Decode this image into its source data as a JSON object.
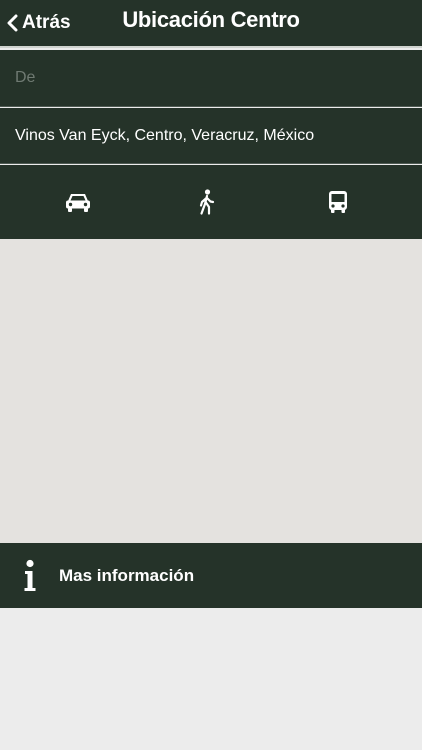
{
  "header": {
    "back_label": "Atrás",
    "title": "Ubicación Centro"
  },
  "route": {
    "from_placeholder": "De",
    "from_value": "",
    "to_value": "Vinos Van Eyck, Centro, Veracruz, México"
  },
  "travel_modes": [
    {
      "icon": "car-icon"
    },
    {
      "icon": "walking-icon"
    },
    {
      "icon": "bus-icon"
    }
  ],
  "info_bar": {
    "icon": "info-icon",
    "label": "Mas información"
  },
  "colors": {
    "panel": "#253329",
    "divider": "#4f5b53",
    "map_background": "#e4e2df",
    "page_background": "#ececec",
    "text": "#ffffff",
    "placeholder": "#6f7a72"
  }
}
